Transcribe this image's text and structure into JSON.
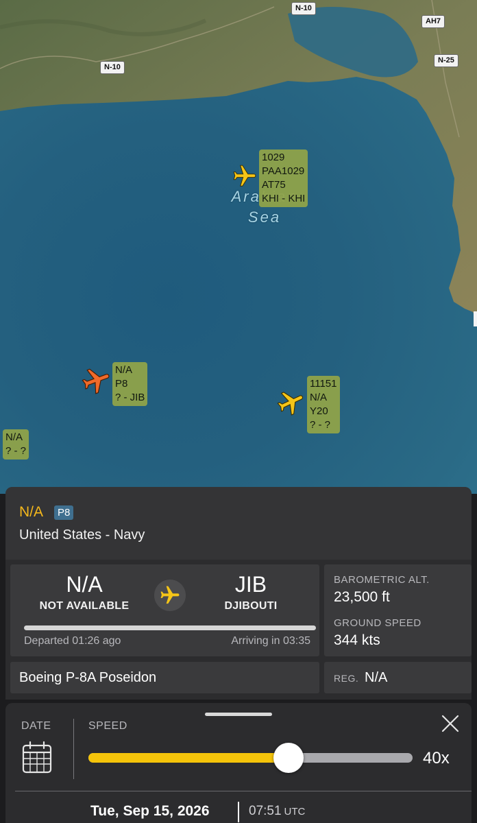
{
  "map": {
    "sea_label_line1": "Arabian",
    "sea_label_line2": "Sea",
    "road_labels": [
      "N-10",
      "N-10",
      "AH7",
      "N-25"
    ],
    "water_color": "#24607f",
    "land_color": "#6f7a4e",
    "flight_tags": [
      {
        "lines": [
          "1029",
          "PAA1029",
          "AT75",
          "KHI - KHI"
        ],
        "plane_color": "#f5c518"
      },
      {
        "lines": [
          "N/A",
          "P8",
          "? - JIB"
        ],
        "plane_color": "#f06a2a",
        "selected": true
      },
      {
        "lines": [
          "11151",
          "N/A",
          "Y20",
          "? - ?"
        ],
        "plane_color": "#f5c518"
      },
      {
        "lines": [
          "N/A",
          "? - ?"
        ]
      }
    ],
    "tag_color": "#8fa34a"
  },
  "flight": {
    "callsign": "N/A",
    "type_code": "P8",
    "operator": "United States - Navy",
    "origin_code": "N/A",
    "origin_name": "NOT AVAILABLE",
    "destination_code": "JIB",
    "destination_name": "DJIBOUTI",
    "departed": "Departed 01:26 ago",
    "arriving": "Arriving in 03:35",
    "baro_alt_label": "BAROMETRIC ALT.",
    "baro_alt_value": "23,500 ft",
    "ground_speed_label": "GROUND SPEED",
    "ground_speed_value": "344 kts",
    "aircraft_name": "Boeing P-8A Poseidon",
    "reg_label": "REG.",
    "reg_value": "N/A",
    "accent_color": "#f5b81c"
  },
  "playback": {
    "date_label": "DATE",
    "speed_label": "SPEED",
    "speed_value": "40x",
    "speed_fraction": 0.62,
    "date_value": "Tue, Sep 15, 2026",
    "time_value": "07:51",
    "timezone": "UTC",
    "slider_color": "#f5c40a",
    "icons": [
      "calendar-icon",
      "close-icon",
      "plane-icon"
    ]
  }
}
